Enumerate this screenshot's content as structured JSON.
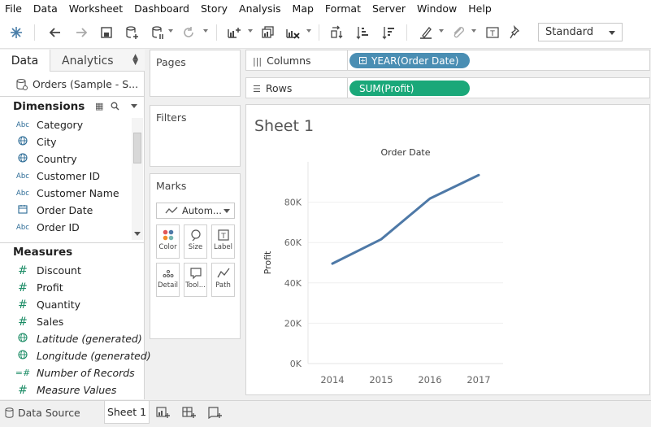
{
  "menu": [
    "File",
    "Data",
    "Worksheet",
    "Dashboard",
    "Story",
    "Analysis",
    "Map",
    "Format",
    "Server",
    "Window",
    "Help"
  ],
  "toolbar": {
    "fit_value": "Standard"
  },
  "data_pane": {
    "tab_data": "Data",
    "tab_analytics": "Analytics",
    "datasource": "Orders (Sample - S...",
    "dimensions_header": "Dimensions",
    "dimensions": [
      {
        "icon": "Abc",
        "label": "Category"
      },
      {
        "icon": "globe-icon",
        "label": "City"
      },
      {
        "icon": "globe-icon",
        "label": "Country"
      },
      {
        "icon": "Abc",
        "label": "Customer ID"
      },
      {
        "icon": "Abc",
        "label": "Customer Name"
      },
      {
        "icon": "calendar-icon",
        "label": "Order Date"
      },
      {
        "icon": "Abc",
        "label": "Order ID"
      }
    ],
    "measures_header": "Measures",
    "measures": [
      {
        "icon": "#",
        "label": "Discount"
      },
      {
        "icon": "#",
        "label": "Profit"
      },
      {
        "icon": "#",
        "label": "Quantity"
      },
      {
        "icon": "#",
        "label": "Sales"
      },
      {
        "icon": "globe-icon",
        "label": "Latitude (generated)"
      },
      {
        "icon": "globe-icon",
        "label": "Longitude (generated)"
      },
      {
        "icon": "=#",
        "label": "Number of Records"
      },
      {
        "icon": "#",
        "label": "Measure Values"
      }
    ]
  },
  "cards": {
    "pages": "Pages",
    "filters": "Filters",
    "marks": "Marks",
    "mark_type": "Autom...",
    "mark_buttons": [
      "Color",
      "Size",
      "Label",
      "Detail",
      "Tool...",
      "Path"
    ]
  },
  "shelves": {
    "columns_label": "Columns",
    "rows_label": "Rows",
    "columns_pill": "YEAR(Order Date)",
    "rows_pill": "SUM(Profit)"
  },
  "view": {
    "sheet_title": "Sheet 1"
  },
  "chart_data": {
    "type": "line",
    "title": "Order Date",
    "xlabel": "",
    "ylabel": "Profit",
    "categories": [
      "2014",
      "2015",
      "2016",
      "2017"
    ],
    "series": [
      {
        "values": [
          49544,
          61619,
          81795,
          93439
        ]
      }
    ],
    "yticks": [
      "0K",
      "20K",
      "40K",
      "60K",
      "80K"
    ],
    "ylim": [
      0,
      100000
    ],
    "line_color": "#4e79a7",
    "grid": true
  },
  "bottom": {
    "data_source_tab": "Data Source",
    "sheet_tab": "Sheet 1"
  }
}
